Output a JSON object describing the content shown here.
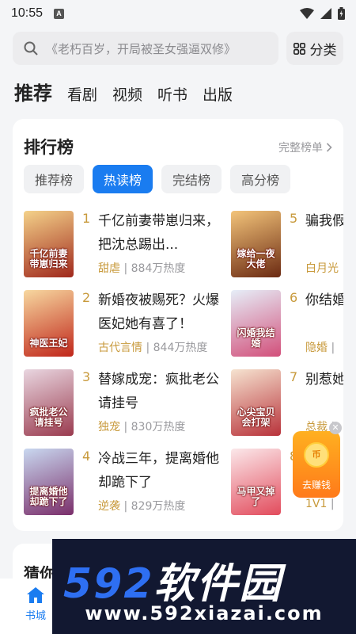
{
  "status_bar": {
    "time": "10:55",
    "indicator": "A",
    "icons": [
      "wifi-icon",
      "signal-icon",
      "battery-icon"
    ]
  },
  "search": {
    "placeholder": "《老朽百岁，开局被圣女强逼双修》",
    "category_label": "分类"
  },
  "main_tabs": [
    "推荐",
    "看剧",
    "视频",
    "听书",
    "出版"
  ],
  "ranking": {
    "title": "排行榜",
    "more_label": "完整榜单",
    "tabs": [
      "推荐榜",
      "热读榜",
      "完结榜",
      "高分榜"
    ],
    "active_tab": "热读榜",
    "books": [
      {
        "rank": "1",
        "title": "千亿前妻带崽归来，把沈总踢出...",
        "tag": "甜虐",
        "heat": "884万热度",
        "cover_text": "千亿前妻带崽归来",
        "cover_colors": [
          "#f4d28a",
          "#a0281c"
        ]
      },
      {
        "rank": "2",
        "title": "新婚夜被赐死？火爆医妃她有喜了！",
        "tag": "古代言情",
        "heat": "844万热度",
        "cover_text": "神医王妃",
        "cover_colors": [
          "#f7d8a0",
          "#c0261a"
        ]
      },
      {
        "rank": "3",
        "title": "替嫁成宠：疯批老公请挂号",
        "tag": "独宠",
        "heat": "830万热度",
        "cover_text": "疯批老公请挂号",
        "cover_colors": [
          "#e9d6e0",
          "#9a3b4f"
        ]
      },
      {
        "rank": "4",
        "title": "冷战三年，提离婚他却跪下了",
        "tag": "逆袭",
        "heat": "829万热度",
        "cover_text": "提离婚他却跪下了",
        "cover_colors": [
          "#c9d8f0",
          "#7a2e6a"
        ]
      },
      {
        "rank": "5",
        "title": "骗我假嫁豪门",
        "tag": "白月光",
        "heat": "",
        "cover_text": "嫁给一夜大佬",
        "cover_colors": [
          "#f3c47a",
          "#6b2a12"
        ]
      },
      {
        "rank": "6",
        "title": "你结婚",
        "tag": "隐婚",
        "heat": "",
        "cover_text": "闪婚我结婚",
        "cover_colors": [
          "#e6eef8",
          "#d24f7a"
        ]
      },
      {
        "rank": "7",
        "title": "别惹她尖宝贝",
        "tag": "总裁",
        "heat": "",
        "cover_text": "心尖宝贝会打架",
        "cover_colors": [
          "#f6e3d0",
          "#b8323a"
        ]
      },
      {
        "rank": "8",
        "title": "",
        "tag": "1V1",
        "heat": "",
        "cover_text": "马甲又掉了",
        "cover_colors": [
          "#fbe8ea",
          "#e24b5c"
        ]
      }
    ]
  },
  "reward": {
    "label": "去赚钱",
    "coin_text": "币"
  },
  "guess": {
    "title": "猜你"
  },
  "bottom_nav": {
    "home_label": "书城"
  },
  "watermark": {
    "logo_num": "592",
    "logo_cn": "软件园",
    "url": "www.592xiazai.com"
  },
  "colors": {
    "accent": "#1a7cf0",
    "rank_gold": "#c89a3c"
  }
}
